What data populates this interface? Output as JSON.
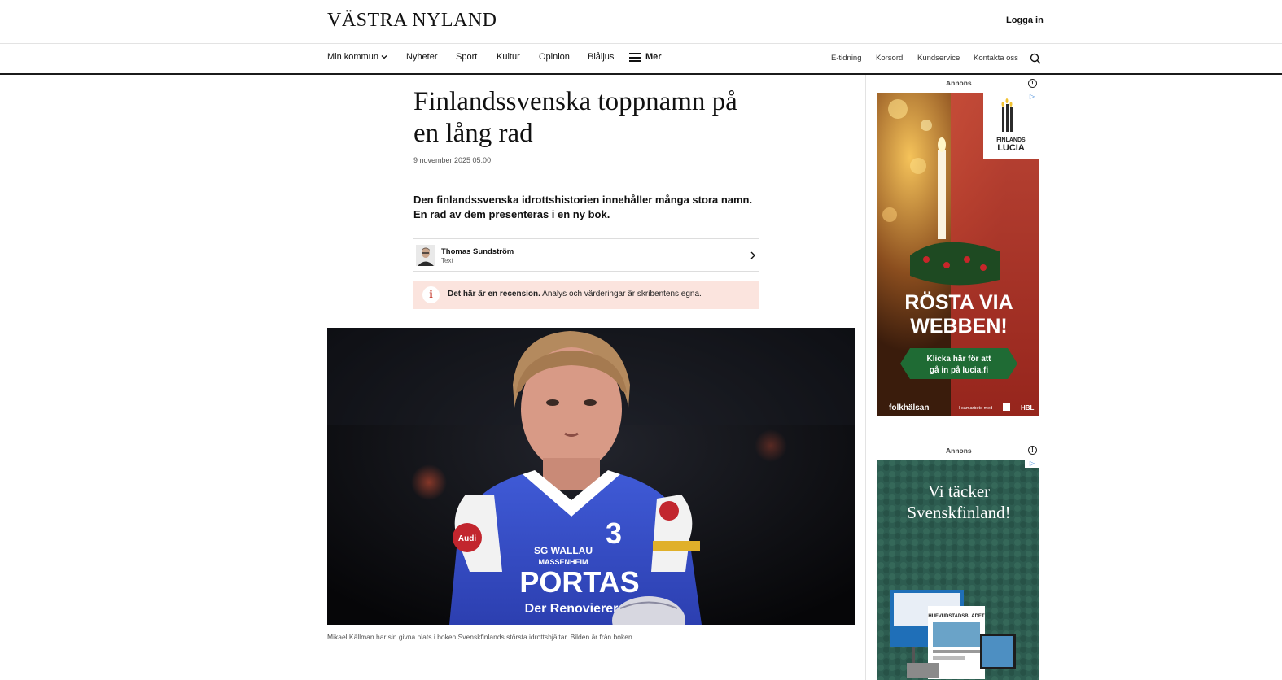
{
  "header": {
    "logo": "VÄSTRA NYLAND",
    "login": "Logga in"
  },
  "nav": {
    "items": [
      "Min kommun",
      "Nyheter",
      "Sport",
      "Kultur",
      "Opinion",
      "Blåljus"
    ],
    "more": "Mer",
    "utility": [
      "E-tidning",
      "Korsord",
      "Kundservice",
      "Kontakta oss"
    ]
  },
  "article": {
    "headline": "Finlandssvenska toppnamn på en lång rad",
    "date": "9 november 2025 05:00",
    "lead": "Den finlandssvenska idrottshistorien innehåller många stora namn. En rad av dem presenteras i en ny bok.",
    "author": {
      "name": "Thomas Sundström",
      "role": "Text"
    },
    "notice": {
      "strong": "Det här är en recension.",
      "rest": " Analys och värderingar är skribentens egna."
    },
    "hero_jersey": {
      "top": "SG WALLAU",
      "sub": "MASSENHEIM",
      "sponsor": "PORTAS",
      "sponsor_sub": "Der Renovierer",
      "number": "3",
      "badge": "Audi"
    },
    "caption": "Mikael Källman har sin givna plats i boken Svenskfinlands största idrottshjältar. Bilden är från boken."
  },
  "ads": {
    "label": "Annons",
    "ad1": {
      "brand_line1": "FINLANDS",
      "brand_line2": "LUCIA",
      "headline_line1": "RÖSTA VIA",
      "headline_line2": "WEBBEN!",
      "cta_line1": "Klicka här för att",
      "cta_line2": "gå in på lucia.fi",
      "footer_brand": "folkhälsan",
      "footer_note": "I samarbete med",
      "footer_partner": "HBL"
    },
    "ad2": {
      "headline_line1": "Vi täcker",
      "headline_line2": "Svenskfinland!",
      "paper_title": "HUFVUDSTADSBLADET"
    }
  }
}
